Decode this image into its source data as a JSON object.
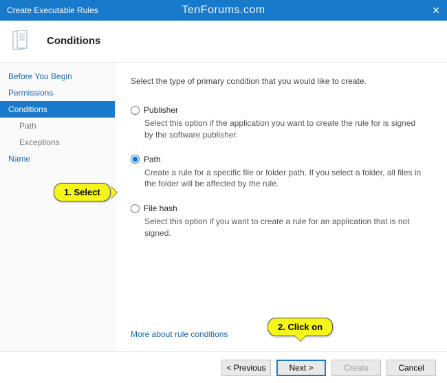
{
  "window": {
    "title": "Create Executable Rules",
    "watermark": "TenForums.com",
    "close": "✕"
  },
  "header": {
    "title": "Conditions"
  },
  "sidebar": {
    "items": [
      {
        "label": "Before You Begin",
        "selected": false,
        "child": false
      },
      {
        "label": "Permissions",
        "selected": false,
        "child": false
      },
      {
        "label": "Conditions",
        "selected": true,
        "child": false
      },
      {
        "label": "Path",
        "selected": false,
        "child": true
      },
      {
        "label": "Exceptions",
        "selected": false,
        "child": true
      },
      {
        "label": "Name",
        "selected": false,
        "child": false
      }
    ]
  },
  "content": {
    "instruction": "Select the type of primary condition that you would like to create.",
    "options": [
      {
        "label": "Publisher",
        "desc": "Select this option if the application you want to create the rule for is signed by the software publisher.",
        "checked": false
      },
      {
        "label": "Path",
        "desc": "Create a rule for a specific file or folder path. If you select a folder, all files in the folder will be affected by the rule.",
        "checked": true
      },
      {
        "label": "File hash",
        "desc": "Select this option if you want to create a rule for an application that is not signed.",
        "checked": false
      }
    ],
    "more_link": "More about rule conditions"
  },
  "footer": {
    "previous": "< Previous",
    "next": "Next >",
    "create": "Create",
    "cancel": "Cancel"
  },
  "callouts": {
    "c1": "1. Select",
    "c2": "2. Click on"
  }
}
